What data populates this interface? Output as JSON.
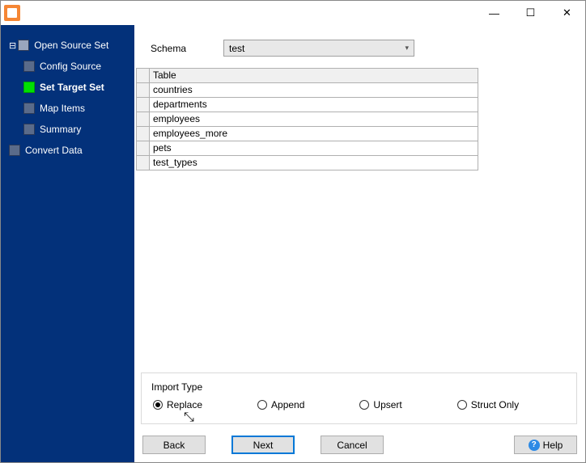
{
  "sidebar": {
    "items": [
      {
        "label": "Open Source Set",
        "level": 1,
        "active": false
      },
      {
        "label": "Config Source",
        "level": 2,
        "active": false
      },
      {
        "label": "Set Target Set",
        "level": 2,
        "active": true
      },
      {
        "label": "Map Items",
        "level": 2,
        "active": false
      },
      {
        "label": "Summary",
        "level": 2,
        "active": false
      },
      {
        "label": "Convert Data",
        "level": 1,
        "active": false
      }
    ]
  },
  "schema": {
    "label": "Schema",
    "value": "test"
  },
  "table": {
    "header": "Table",
    "rows": [
      "countries",
      "departments",
      "employees",
      "employees_more",
      "pets",
      "test_types"
    ]
  },
  "importType": {
    "title": "Import Type",
    "options": [
      "Replace",
      "Append",
      "Upsert",
      "Struct Only"
    ],
    "selected": "Replace"
  },
  "buttons": {
    "back": "Back",
    "next": "Next",
    "cancel": "Cancel",
    "help": "Help"
  }
}
